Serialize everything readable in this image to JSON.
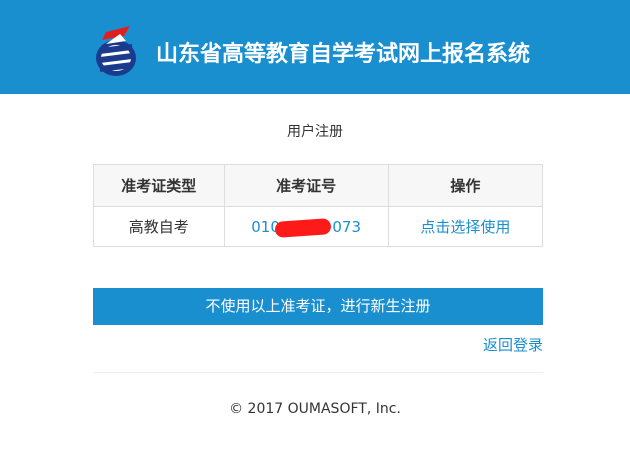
{
  "header": {
    "title": "山东省高等教育自学考试网上报名系统",
    "logo_icon": "exam-system-logo-icon",
    "background_color": "#1a8fd0"
  },
  "page_title": "用户注册",
  "ticket_table": {
    "headers": [
      "准考证类型",
      "准考证号",
      "操作"
    ],
    "rows": [
      {
        "type": "高教自考",
        "number_prefix": "010",
        "number_suffix": "073",
        "action": "点击选择使用"
      }
    ]
  },
  "new_register_button": "不使用以上准考证，进行新生注册",
  "back_login_link": "返回登录",
  "footer": "© 2017 OUMASOFT, Inc.",
  "colors": {
    "accent": "#1a8fd0",
    "redaction": "#ff1a1a"
  }
}
